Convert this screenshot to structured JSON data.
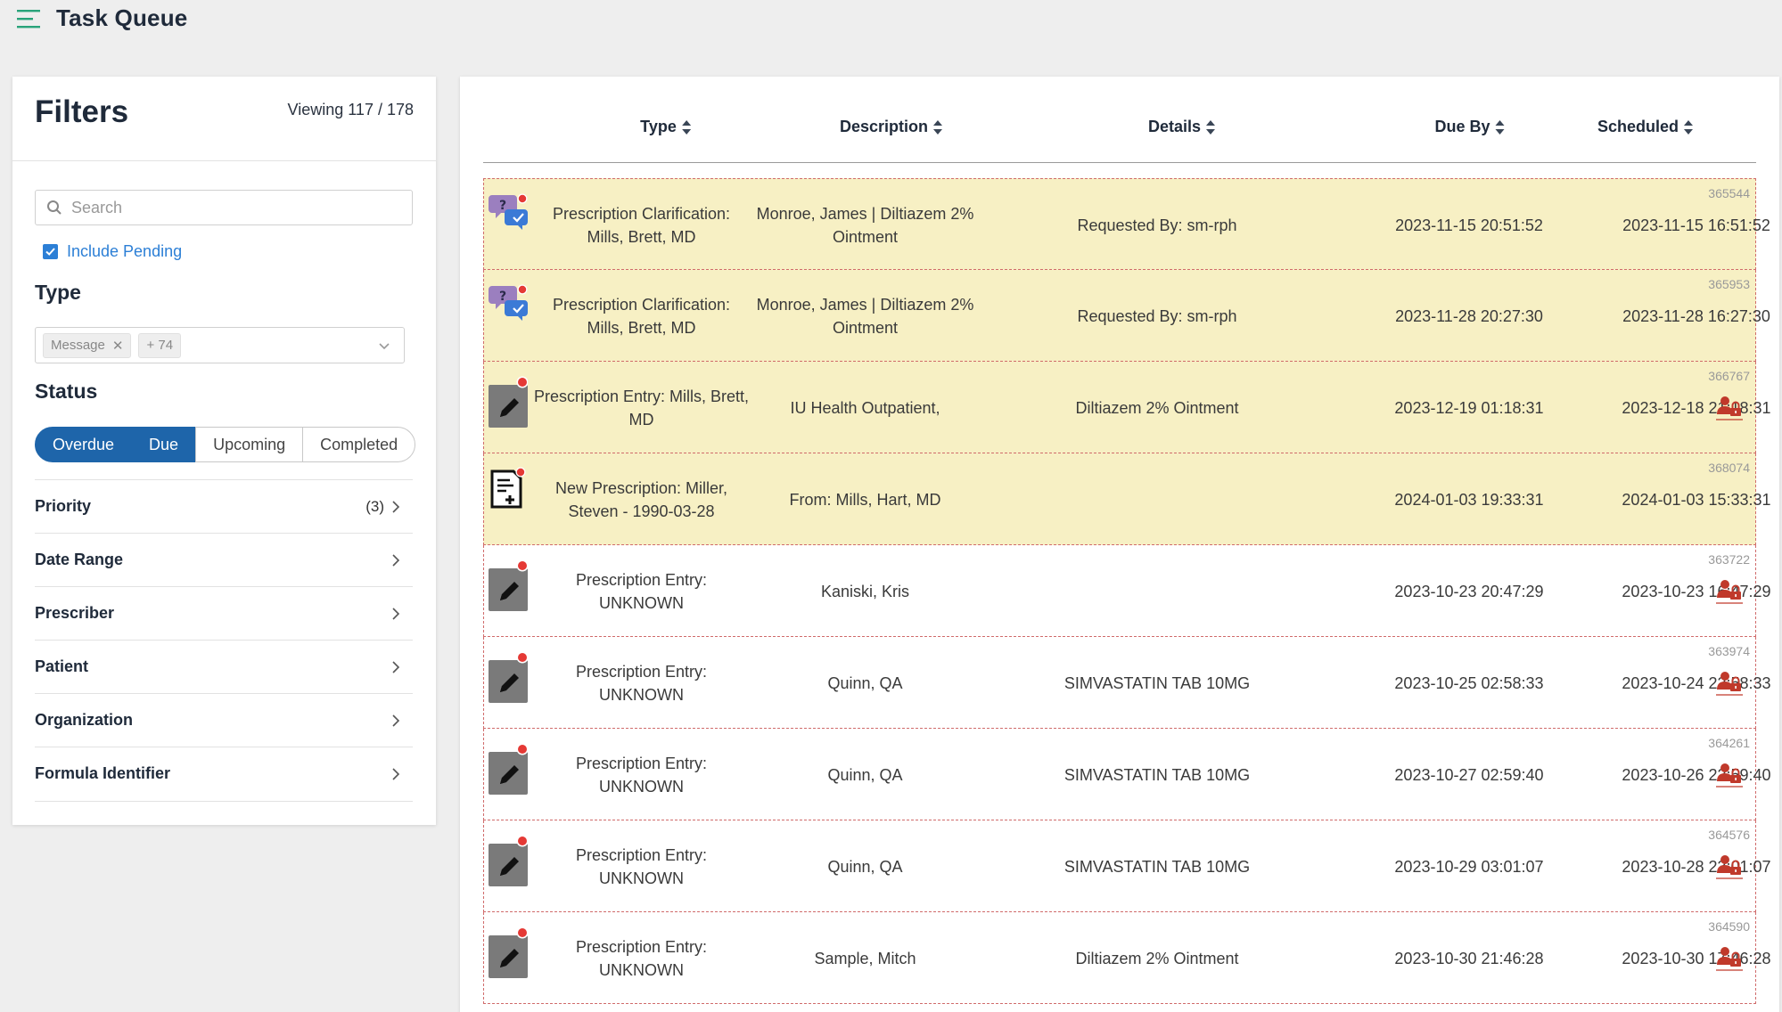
{
  "app": {
    "title": "Task Queue"
  },
  "filters": {
    "title": "Filters",
    "viewing": "Viewing 117 / 178",
    "search_placeholder": "Search",
    "include_pending": "Include Pending",
    "type_title": "Type",
    "type_tags": [
      "Message",
      "+ 74"
    ],
    "status_title": "Status",
    "status_options": [
      "Overdue",
      "Due",
      "Upcoming",
      "Completed"
    ],
    "status_active": [
      "Overdue",
      "Due"
    ],
    "sections": [
      {
        "label": "Priority",
        "count": "(3)"
      },
      {
        "label": "Date Range",
        "count": ""
      },
      {
        "label": "Prescriber",
        "count": ""
      },
      {
        "label": "Patient",
        "count": ""
      },
      {
        "label": "Organization",
        "count": ""
      },
      {
        "label": "Formula Identifier",
        "count": ""
      }
    ]
  },
  "table": {
    "columns": [
      "Type",
      "Description",
      "Details",
      "Due By",
      "Scheduled"
    ],
    "rows": [
      {
        "id": "365544",
        "icon": "chat-question-icon",
        "highlight": true,
        "type": "Prescription Clarification: Mills, Brett, MD",
        "description": "Monroe, James | Diltiazem 2% Ointment",
        "details": "Requested By: sm-rph",
        "due_by": "2023-11-15 20:51:52",
        "scheduled": "2023-11-15 16:51:52",
        "locked": false
      },
      {
        "id": "365953",
        "icon": "chat-question-icon",
        "highlight": true,
        "type": "Prescription Clarification: Mills, Brett, MD",
        "description": "Monroe, James | Diltiazem 2% Ointment",
        "details": "Requested By: sm-rph",
        "due_by": "2023-11-28 20:27:30",
        "scheduled": "2023-11-28 16:27:30",
        "locked": false
      },
      {
        "id": "366767",
        "icon": "edit-icon",
        "highlight": true,
        "type": "Prescription Entry: Mills, Brett, MD",
        "description": "IU Health Outpatient,",
        "details": "Diltiazem 2% Ointment",
        "due_by": "2023-12-19 01:18:31",
        "scheduled": "2023-12-18 21:18:31",
        "locked": true
      },
      {
        "id": "368074",
        "icon": "new-prescription-icon",
        "highlight": true,
        "type": "New Prescription: Miller, Steven - 1990-03-28",
        "description": "From: Mills, Hart, MD",
        "details": "",
        "due_by": "2024-01-03 19:33:31",
        "scheduled": "2024-01-03 15:33:31",
        "locked": false
      },
      {
        "id": "363722",
        "icon": "edit-icon",
        "highlight": false,
        "type": "Prescription Entry: UNKNOWN",
        "description": "Kaniski, Kris",
        "details": "",
        "due_by": "2023-10-23 20:47:29",
        "scheduled": "2023-10-23 16:47:29",
        "locked": true
      },
      {
        "id": "363974",
        "icon": "edit-icon",
        "highlight": false,
        "type": "Prescription Entry: UNKNOWN",
        "description": "Quinn, QA",
        "details": "SIMVASTATIN TAB 10MG",
        "due_by": "2023-10-25 02:58:33",
        "scheduled": "2023-10-24 22:58:33",
        "locked": true
      },
      {
        "id": "364261",
        "icon": "edit-icon",
        "highlight": false,
        "type": "Prescription Entry: UNKNOWN",
        "description": "Quinn, QA",
        "details": "SIMVASTATIN TAB 10MG",
        "due_by": "2023-10-27 02:59:40",
        "scheduled": "2023-10-26 22:59:40",
        "locked": true
      },
      {
        "id": "364576",
        "icon": "edit-icon",
        "highlight": false,
        "type": "Prescription Entry: UNKNOWN",
        "description": "Quinn, QA",
        "details": "SIMVASTATIN TAB 10MG",
        "due_by": "2023-10-29 03:01:07",
        "scheduled": "2023-10-28 23:01:07",
        "locked": true
      },
      {
        "id": "364590",
        "icon": "edit-icon",
        "highlight": false,
        "type": "Prescription Entry: UNKNOWN",
        "description": "Sample, Mitch",
        "details": "Diltiazem 2% Ointment",
        "due_by": "2023-10-30 21:46:28",
        "scheduled": "2023-10-30 17:46:28",
        "locked": true
      }
    ]
  },
  "colors": {
    "accent": "#1e65aa",
    "link": "#2c7fd6",
    "highlight_row": "#f7f0c4",
    "lock": "#c0392b",
    "menu": "#29a37a"
  }
}
